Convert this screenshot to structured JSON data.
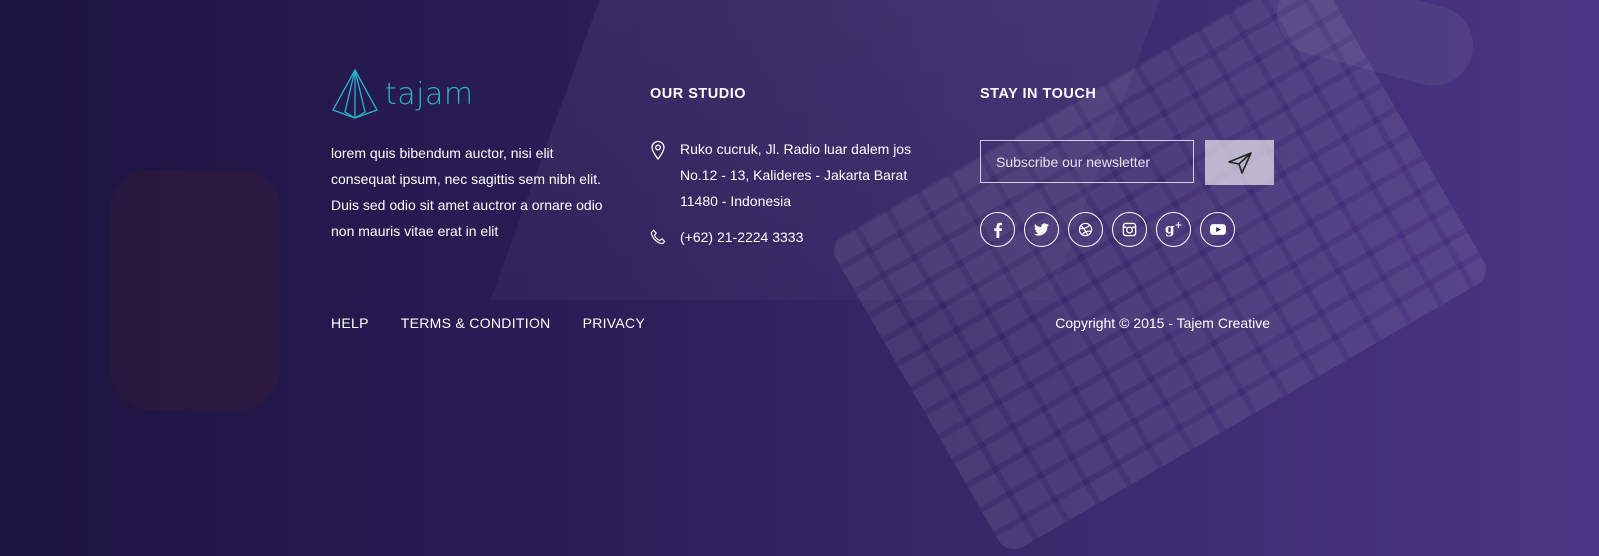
{
  "brand": {
    "name": "tajam",
    "about": "lorem quis bibendum auctor, nisi elit consequat ipsum, nec sagittis sem nibh elit. Duis sed odio sit amet auctror a ornare odio non mauris vitae erat in elit"
  },
  "studio": {
    "title": "OUR STUDIO",
    "address": "Ruko cucruk, Jl. Radio luar dalem jos No.12 - 13, Kalideres - Jakarta Barat 11480 - Indonesia",
    "phone": "(+62) 21-2224 3333"
  },
  "touch": {
    "title": "STAY IN TOUCH",
    "newsletter_placeholder": "Subscribe our newsletter",
    "socials": [
      {
        "name": "facebook",
        "glyph": "f"
      },
      {
        "name": "twitter",
        "glyph": "t"
      },
      {
        "name": "dribbble",
        "glyph": "d"
      },
      {
        "name": "instagram",
        "glyph": "i"
      },
      {
        "name": "google-plus",
        "glyph": "g+"
      },
      {
        "name": "youtube",
        "glyph": "y"
      }
    ]
  },
  "bottom": {
    "links": [
      "HELP",
      "TERMS & CONDITION",
      "PRIVACY"
    ],
    "copyright": "Copyright © 2015 - Tajem Creative"
  },
  "colors": {
    "brand_accent": "#2ab3c9",
    "background_left": "#1c1440",
    "background_right": "#4b3584"
  }
}
